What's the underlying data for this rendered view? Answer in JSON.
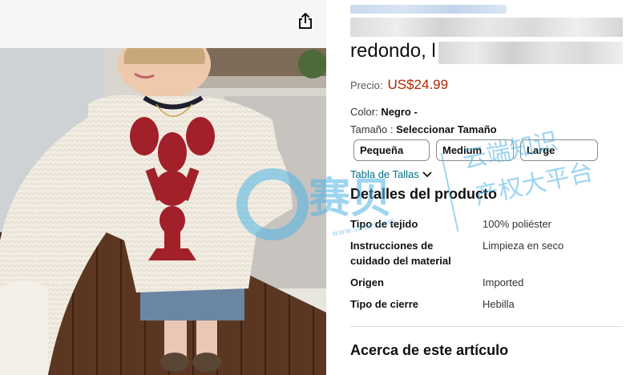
{
  "product": {
    "title_visible": "redondo, l",
    "price_label": "Precio:",
    "price": "US$24.99",
    "color_label": "Color:",
    "color_value": "Negro -",
    "size_label": "Tamaño :",
    "size_value": "Seleccionar Tamaño",
    "sizes": [
      "Pequeña",
      "Medium",
      "Large"
    ],
    "size_chart_link": "Tabla de Tallas"
  },
  "details": {
    "heading": "Detalles del producto",
    "rows": [
      {
        "label": "Tipo de tejido",
        "value": "100% poliéster"
      },
      {
        "label": "Instrucciones de cuidado del material",
        "value": "Limpieza en seco"
      },
      {
        "label": "Origen",
        "value": "Imported"
      },
      {
        "label": "Tipo de cierre",
        "value": "Hebilla"
      }
    ]
  },
  "about": {
    "heading": "Acerca de este artículo"
  },
  "watermark": {
    "brand": "赛贝",
    "line1": "云端知识",
    "line2": "产权大平台",
    "url": "www.saibei.com"
  },
  "colors": {
    "price": "#b12704",
    "link": "#007185",
    "watermark": "#4fb4e6"
  }
}
